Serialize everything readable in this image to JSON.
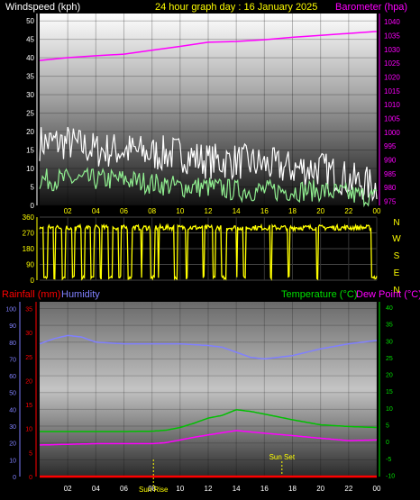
{
  "header": {
    "left_label": "Windspeed (kph)",
    "title": "24 hour graph day : 16 January 2025",
    "right_label": "Barometer (hpa)"
  },
  "compass": {
    "labels": [
      "N",
      "W",
      "S",
      "E",
      "N"
    ]
  },
  "lower_header": {
    "rainfall_label": "Rainfall (mm)",
    "humidity_label": "Humidity",
    "temperature_label": "Temperature (°C)",
    "dewpoint_label": "Dew Point (°C)"
  },
  "sun": {
    "sunrise_label": "Sun Rise",
    "sunset_label": "Sun Set",
    "sunrise_hour": 8.1,
    "sunset_hour": 17.25
  },
  "colors": {
    "background": "#000000",
    "wind_avg": "#90ee90",
    "wind_gust": "#ffffff",
    "barometer": "#ff00ff",
    "direction": "#ffff00",
    "rainfall": "#ff0000",
    "humidity": "#8080ff",
    "temperature": "#00c000",
    "dewpoint": "#ff00ff",
    "sun_marker": "#ffff00"
  },
  "chart_data": [
    {
      "type": "line",
      "name": "wind-barometer",
      "x_tick_labels": [
        "02",
        "04",
        "06",
        "08",
        "10",
        "12",
        "14",
        "16",
        "18",
        "20",
        "22",
        "00"
      ],
      "x_range": [
        0,
        24
      ],
      "left_axis": {
        "ticks": [
          0,
          5,
          10,
          15,
          20,
          25,
          30,
          35,
          40,
          45,
          50
        ],
        "range": [
          0,
          52
        ]
      },
      "right_axis": {
        "ticks": [
          975,
          980,
          985,
          990,
          995,
          1000,
          1005,
          1010,
          1015,
          1020,
          1025,
          1030,
          1035,
          1040
        ],
        "range": [
          973.5,
          1043
        ]
      },
      "series": [
        {
          "name": "Barometer (hpa)",
          "axis": "right",
          "x": [
            0,
            2,
            4,
            6,
            8,
            10,
            12,
            14,
            16,
            18,
            20,
            22,
            24
          ],
          "y": [
            1026,
            1027,
            1027.7,
            1028.3,
            1029.7,
            1031.1,
            1032.6,
            1032.9,
            1033.5,
            1034.4,
            1035.1,
            1035.8,
            1036.5
          ]
        },
        {
          "name": "gust",
          "axis": "left",
          "x": [
            0,
            2,
            4,
            6,
            8,
            10,
            12,
            14,
            16,
            18,
            20,
            22,
            24
          ],
          "y": [
            17,
            17,
            15,
            15,
            14,
            14,
            12,
            12,
            11,
            10,
            10,
            7,
            5
          ],
          "noise": 5
        },
        {
          "name": "average",
          "axis": "left",
          "x": [
            0,
            2,
            4,
            6,
            8,
            10,
            12,
            14,
            16,
            18,
            20,
            22,
            24
          ],
          "y": [
            7,
            7,
            7,
            7,
            6,
            5,
            5,
            4,
            4,
            4,
            4,
            3,
            2
          ],
          "noise": 3
        }
      ]
    },
    {
      "type": "line",
      "name": "wind-direction",
      "left_axis": {
        "ticks": [
          0,
          90,
          180,
          270,
          360
        ],
        "range": [
          0,
          360
        ]
      },
      "x_range": [
        0,
        24
      ],
      "series": [
        {
          "name": "direction",
          "baseline": 300,
          "dips": [
            [
              0.3,
              0.6
            ],
            [
              1.0,
              1.1
            ],
            [
              1.6,
              1.8
            ],
            [
              2.3,
              2.5
            ],
            [
              3.0,
              3.2
            ],
            [
              3.6,
              3.9
            ],
            [
              4.3,
              4.4
            ],
            [
              4.9,
              5.2
            ],
            [
              5.6,
              5.8
            ],
            [
              6.3,
              6.6
            ],
            [
              7.2,
              7.3
            ],
            [
              7.9,
              8.2
            ],
            [
              8.4,
              8.5
            ],
            [
              9.6,
              9.8
            ],
            [
              10.4,
              10.5
            ],
            [
              11.6,
              11.7
            ],
            [
              12.3,
              12.5
            ],
            [
              12.9,
              13.3
            ],
            [
              14.0,
              14.1
            ],
            [
              14.5,
              14.7
            ],
            [
              16.4,
              16.5
            ],
            [
              17.7,
              17.8
            ],
            [
              19.7,
              19.8
            ],
            [
              23.6,
              24.0
            ]
          ]
        }
      ]
    },
    {
      "type": "line",
      "name": "temperature-humidity-rain",
      "x_tick_labels": [
        "02",
        "04",
        "06",
        "08",
        "10",
        "12",
        "14",
        "16",
        "18",
        "20",
        "22",
        "00"
      ],
      "x_range": [
        0,
        24
      ],
      "left_axis_humidity": {
        "ticks": [
          0,
          10,
          20,
          30,
          40,
          50,
          60,
          70,
          80,
          90,
          100
        ],
        "range": [
          0,
          100
        ]
      },
      "left_axis_rain": {
        "ticks": [
          0,
          5,
          10,
          15,
          20,
          25,
          30,
          35
        ],
        "range": [
          0,
          35
        ]
      },
      "right_axis_temp": {
        "ticks": [
          -10,
          -5,
          0,
          5,
          10,
          15,
          20,
          25,
          30,
          35,
          40
        ],
        "range": [
          -10,
          40
        ]
      },
      "series": [
        {
          "name": "Humidity",
          "axis": "humidity",
          "x": [
            0,
            1,
            2,
            3,
            4,
            6,
            8,
            10,
            12,
            13,
            14,
            15,
            16,
            18,
            20,
            22,
            24
          ],
          "y": [
            79,
            82,
            84,
            83,
            80,
            79,
            79,
            79,
            78,
            77,
            74,
            71,
            70,
            72,
            76,
            79,
            81
          ]
        },
        {
          "name": "Temperature (°C)",
          "axis": "temp",
          "x": [
            0,
            2,
            4,
            6,
            8,
            9,
            10,
            11,
            12,
            13,
            14,
            15,
            16,
            18,
            20,
            22,
            24
          ],
          "y": [
            3.0,
            3.0,
            3.0,
            3.0,
            3.1,
            3.4,
            4.2,
            5.5,
            7.0,
            7.8,
            9.5,
            9.0,
            8.2,
            6.5,
            5.0,
            4.5,
            4.2
          ]
        },
        {
          "name": "Dew Point (°C)",
          "axis": "temp",
          "x": [
            0,
            2,
            4,
            6,
            8,
            9,
            10,
            11,
            12,
            14,
            16,
            18,
            20,
            22,
            24
          ],
          "y": [
            -1.0,
            -0.8,
            -0.6,
            -0.6,
            -0.6,
            -0.3,
            0.5,
            1.3,
            2.0,
            3.3,
            2.5,
            1.8,
            1.0,
            0.3,
            0.5
          ]
        },
        {
          "name": "Rainfall (mm)",
          "axis": "rain",
          "x": [
            0,
            24
          ],
          "y": [
            0,
            0
          ]
        }
      ]
    }
  ]
}
